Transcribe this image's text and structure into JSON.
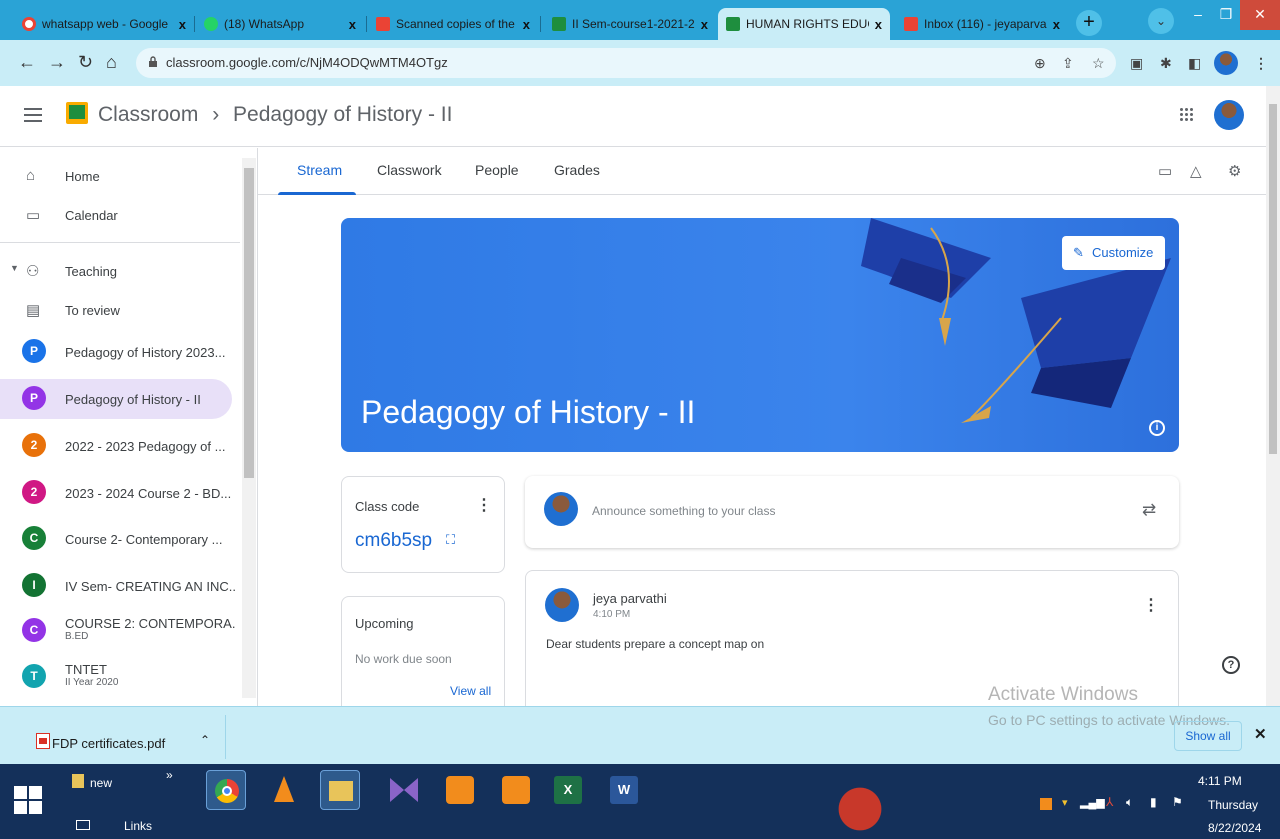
{
  "browser": {
    "tabs": [
      {
        "title": "whatsapp web - Google",
        "favicon_color": "#ea4335",
        "active": false
      },
      {
        "title": "(18) WhatsApp",
        "favicon_color": "#25d366",
        "active": false
      },
      {
        "title": "Scanned copies of the F",
        "favicon_color": "#ea4335",
        "active": false
      },
      {
        "title": "II Sem-course1-2021-2",
        "favicon_color": "#1e8e3e",
        "active": false
      },
      {
        "title": "HUMAN RIGHTS EDUC",
        "favicon_color": "#1e8e3e",
        "active": true
      },
      {
        "title": "Inbox (116) - jeyaparva",
        "favicon_color": "#ea4335",
        "active": false
      }
    ],
    "close_glyph": "x",
    "newtab_glyph": "+",
    "url": "classroom.google.com/c/NjM4ODQwMTM4OTgz"
  },
  "app": {
    "name": "Classroom",
    "breadcrumb_sep": "›",
    "course_title": "Pedagogy of History - II"
  },
  "sidebar": {
    "items": [
      {
        "label": "Home",
        "icon": "home-icon"
      },
      {
        "label": "Calendar",
        "icon": "calendar-icon"
      },
      {
        "label": "Teaching",
        "icon": "people-icon"
      },
      {
        "label": "To review",
        "icon": "review-icon"
      }
    ],
    "classes": [
      {
        "letter": "P",
        "label": "Pedagogy of History 2023...",
        "sub": "",
        "color": "#1a73e8"
      },
      {
        "letter": "P",
        "label": "Pedagogy of History - II",
        "sub": "",
        "color": "#9334e6",
        "selected": true
      },
      {
        "letter": "2",
        "label": "2022 - 2023 Pedagogy of ...",
        "sub": "",
        "color": "#e8710a"
      },
      {
        "letter": "2",
        "label": "2023 - 2024 Course 2 - BD...",
        "sub": "",
        "color": "#d01884"
      },
      {
        "letter": "C",
        "label": "Course 2- Contemporary ...",
        "sub": "",
        "color": "#188038"
      },
      {
        "letter": "I",
        "label": "IV Sem- CREATING AN INC...",
        "sub": "",
        "color": "#137333"
      },
      {
        "letter": "C",
        "label": "COURSE 2: CONTEMPORA...",
        "sub": "B.ED",
        "color": "#9334e6"
      },
      {
        "letter": "T",
        "label": "TNTET",
        "sub": "II Year 2020",
        "color": "#12a4af"
      }
    ]
  },
  "course_tabs": [
    "Stream",
    "Classwork",
    "People",
    "Grades"
  ],
  "banner": {
    "title": "Pedagogy of History - II",
    "customize_label": "Customize"
  },
  "class_code": {
    "label": "Class code",
    "code": "cm6b5sp"
  },
  "upcoming": {
    "label": "Upcoming",
    "status": "No work due soon",
    "link": "View all"
  },
  "announce": {
    "placeholder": "Announce something to your class"
  },
  "post": {
    "author": "jeya parvathi",
    "time": "4:10 PM",
    "text": "Dear students prepare a concept map on"
  },
  "watermark": {
    "line1": "Activate Windows",
    "line2": "Go to PC settings to activate Windows."
  },
  "download": {
    "file": "FDP certificates.pdf",
    "show_all": "Show all"
  },
  "taskbar": {
    "toolbar_label": "new",
    "links_label": "Links",
    "time": "4:11 PM",
    "day": "Thursday",
    "date": "8/22/2024"
  }
}
